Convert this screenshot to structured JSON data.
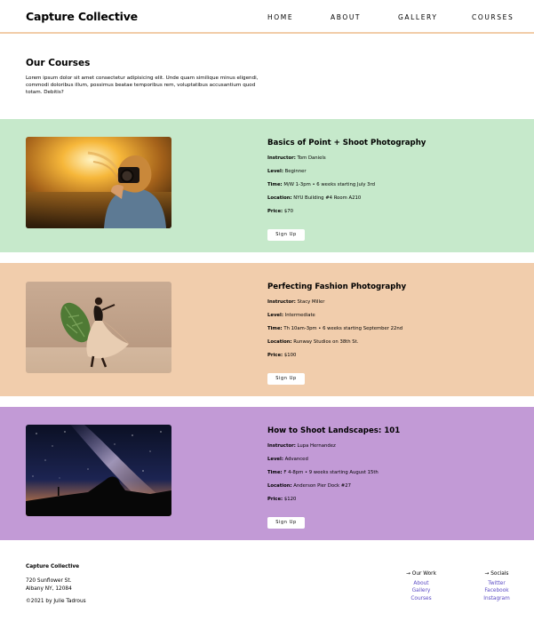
{
  "header": {
    "logo": "Capture Collective",
    "nav": [
      "HOME",
      "ABOUT",
      "GALLERY",
      "COURSES"
    ]
  },
  "intro": {
    "title": "Our Courses",
    "text": "Lorem ipsum dolor sit amet consectetur adipisicing elit. Unde quam similique minus eligendi, commodi doloribus illum, possimus beatae temporibus rem, voluptatibus accusantium quod totam. Debitis?"
  },
  "labels": {
    "instructor": "Instructor:",
    "level": "Level:",
    "time": "Time:",
    "location": "Location:",
    "price": "Price:"
  },
  "courses": [
    {
      "title": "Basics of Point + Shoot Photography",
      "instructor": "Tom Daniels",
      "level": "Beginner",
      "time": "M/W 1-3pm • 6 weeks starting July 3rd",
      "location": "NYU Building #4 Room A210",
      "price": "$70",
      "button": "Sign Up",
      "bg": "#c6e9cb"
    },
    {
      "title": "Perfecting Fashion Photography",
      "instructor": "Stacy Miller",
      "level": "Intermediate",
      "time": "Th 10am-3pm • 6 weeks starting September 22nd",
      "location": "Runway Studios on 38th St.",
      "price": "$100",
      "button": "Sign Up",
      "bg": "#f1cdac"
    },
    {
      "title": "How to Shoot Landscapes: 101",
      "instructor": "Lupa Hernandez",
      "level": "Advanced",
      "time": "F 4-8pm • 9 weeks starting August 15th",
      "location": "Anderson Pier Dock #27",
      "price": "$120",
      "button": "Sign Up",
      "bg": "#c29ad6"
    }
  ],
  "footer": {
    "brand": "Capture Collective",
    "address1": "720 Sunflower St.",
    "address2": "Albany NY, 12084",
    "copyright": "©2021 by Julie Tadrous",
    "work_heading": "→ Our Work",
    "work_links": [
      "About",
      "Gallery",
      "Courses"
    ],
    "social_heading": "→ Socials",
    "social_links": [
      "Twitter",
      "Facebook",
      "Instagram"
    ],
    "link_color": "#5b4bc4"
  }
}
